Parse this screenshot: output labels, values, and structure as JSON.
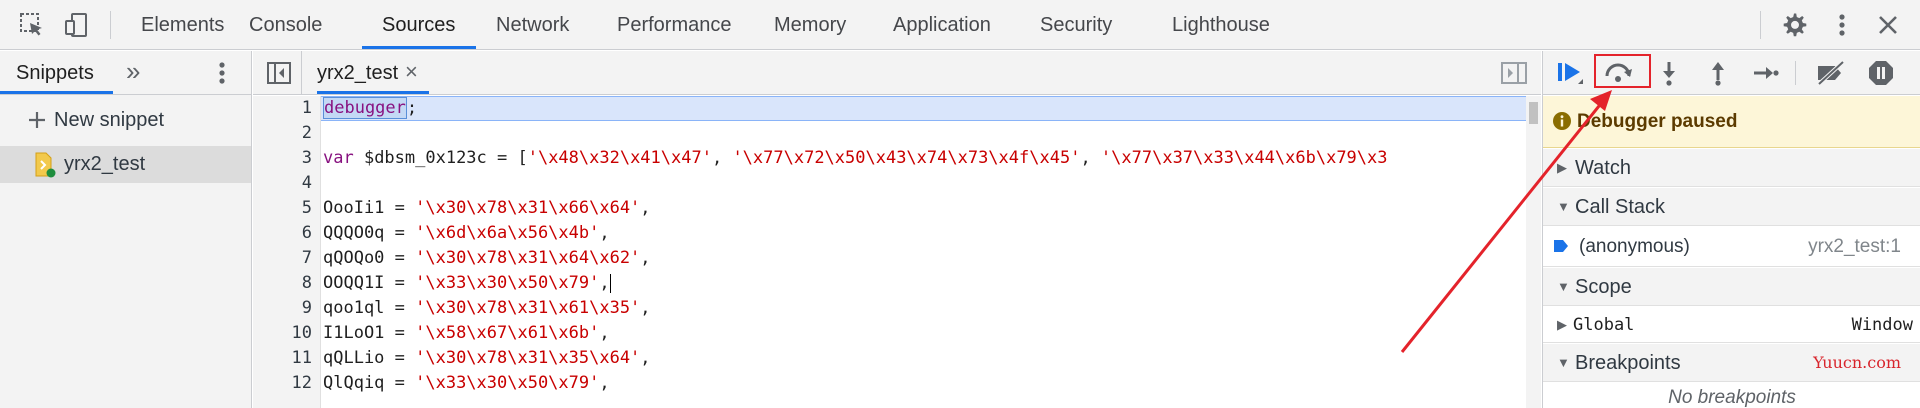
{
  "toolbar": {
    "tabs": [
      "Elements",
      "Console",
      "Sources",
      "Network",
      "Performance",
      "Memory",
      "Application",
      "Security",
      "Lighthouse"
    ],
    "selected_tab": "Sources",
    "accent_color": "#1a73e8"
  },
  "navigator": {
    "tab_label": "Snippets",
    "more_tabs_label": "»",
    "new_snippet_label": "New snippet",
    "snippet_name": "yrx2_test"
  },
  "editor": {
    "file_tab": "yrx2_test",
    "close_label": "×",
    "line_numbers": [
      "1",
      "2",
      "3",
      "4",
      "5",
      "6",
      "7",
      "8",
      "9",
      "10",
      "11",
      "12"
    ],
    "lines": {
      "l1_keyword": "debugger",
      "l1_rest": ";",
      "l3_var": "var",
      "l3_name": " $dbsm_0x123c = [",
      "l3_s1": "'\\x48\\x32\\x41\\x47'",
      "l3_c1": ", ",
      "l3_s2": "'\\x77\\x72\\x50\\x43\\x74\\x73\\x4f\\x45'",
      "l3_c2": ", ",
      "l3_s3": "'\\x77\\x37\\x33\\x44\\x6b\\x79\\x3",
      "l5_name": "OooIi1 = ",
      "l5_str": "'\\x30\\x78\\x31\\x66\\x64'",
      "l6_name": "QQQO0q = ",
      "l6_str": "'\\x6d\\x6a\\x56\\x4b'",
      "l7_name": "qQOQo0 = ",
      "l7_str": "'\\x30\\x78\\x31\\x64\\x62'",
      "l8_name": "OOQQ1I = ",
      "l8_str": "'\\x33\\x30\\x50\\x79'",
      "l9_name": "qoo1ql = ",
      "l9_str": "'\\x30\\x78\\x31\\x61\\x35'",
      "l10_name": "I1LoO1 = ",
      "l10_str": "'\\x58\\x67\\x61\\x6b'",
      "l11_name": "qQLLio = ",
      "l11_str": "'\\x30\\x78\\x31\\x35\\x64'",
      "l12_name": "QlQqiq = ",
      "l12_str": "'\\x33\\x30\\x50\\x79'",
      "comma": ","
    }
  },
  "debugger": {
    "paused_text": "Debugger paused",
    "watch_label": "Watch",
    "call_stack_label": "Call Stack",
    "frame_name": "(anonymous)",
    "frame_location": "yrx2_test:1",
    "scope_label": "Scope",
    "global_label": "Global",
    "global_value": "Window",
    "breakpoints_label": "Breakpoints",
    "no_breakpoints": "No breakpoints",
    "watermark": "Yuucn.com"
  },
  "annotation": {
    "highlight_color": "#e4232b"
  }
}
